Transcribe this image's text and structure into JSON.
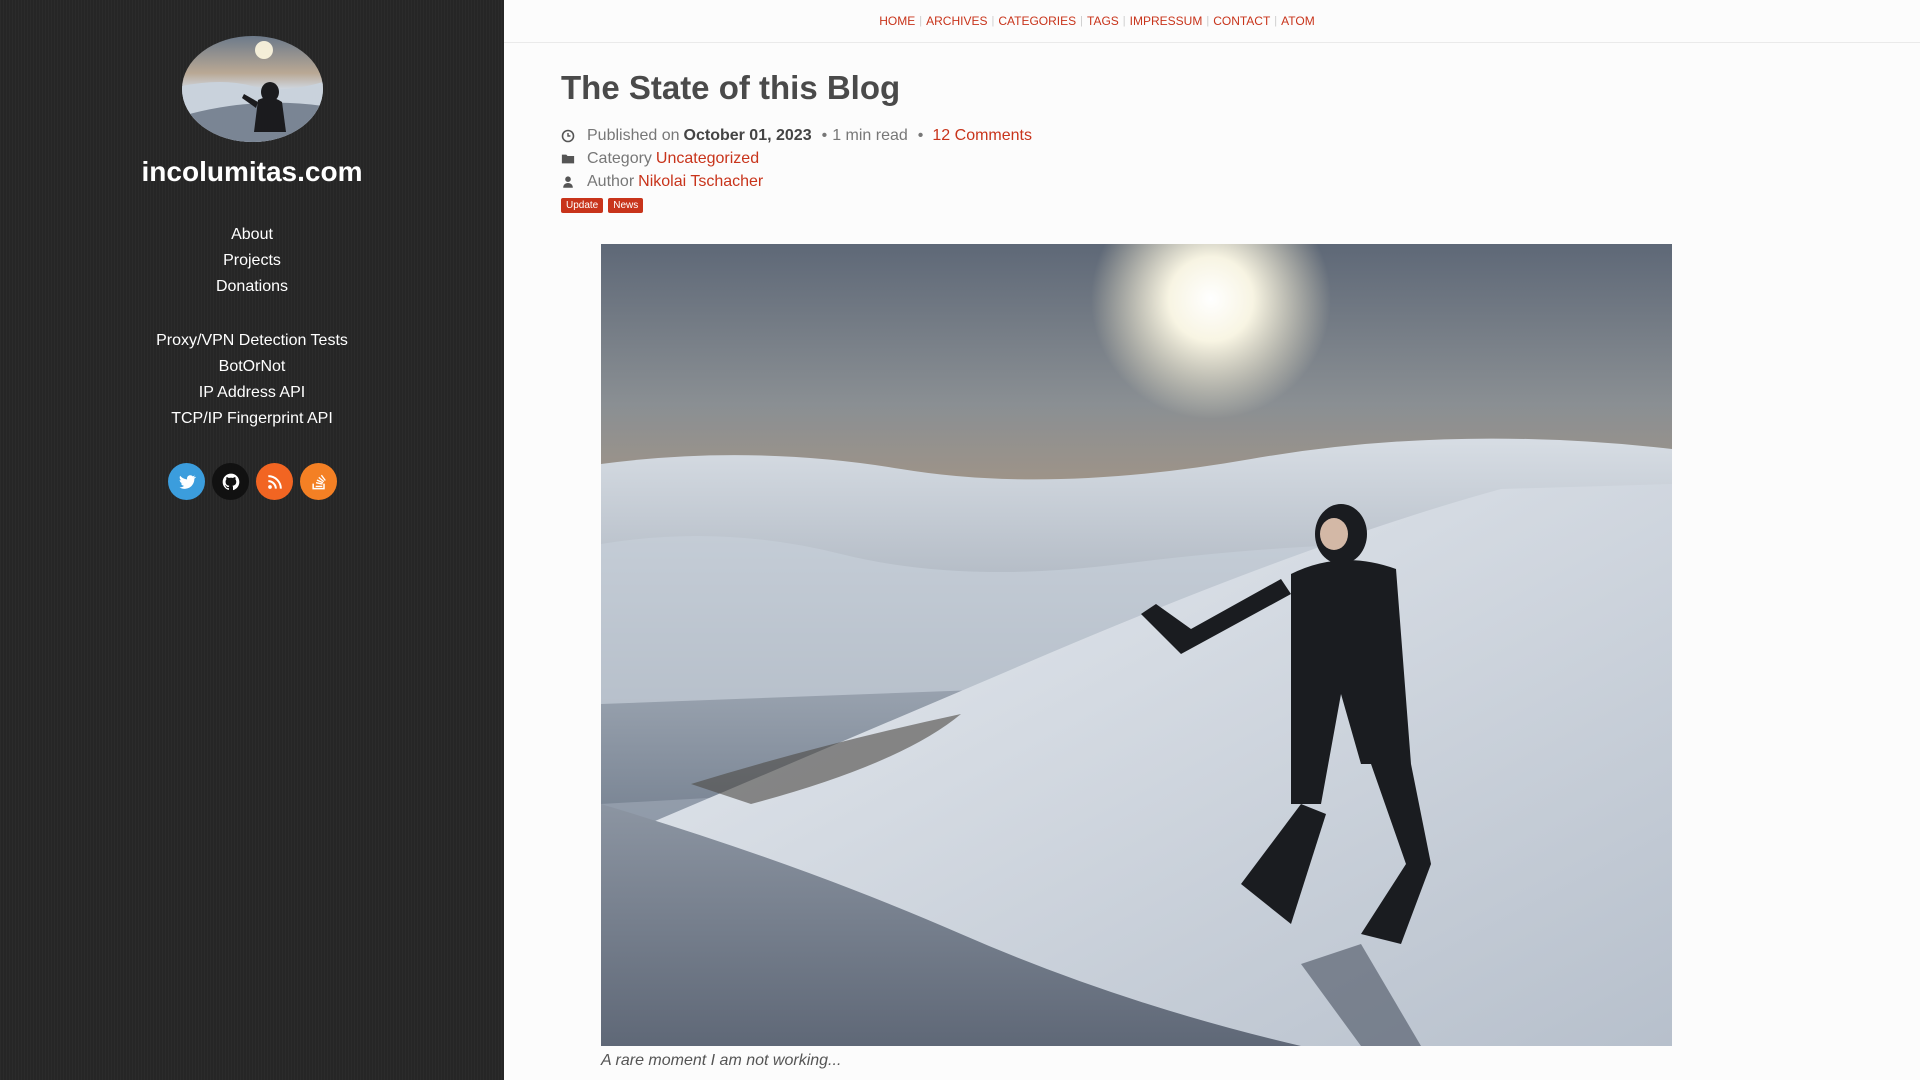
{
  "sidebar": {
    "site_title": "incolumitas.com",
    "nav_primary": [
      {
        "label": "About"
      },
      {
        "label": "Projects"
      },
      {
        "label": "Donations"
      }
    ],
    "nav_secondary": [
      {
        "label": "Proxy/VPN Detection Tests"
      },
      {
        "label": "BotOrNot"
      },
      {
        "label": "IP Address API"
      },
      {
        "label": "TCP/IP Fingerprint API"
      }
    ],
    "social": [
      {
        "icon": "twitter-icon",
        "color": "#3b9ddd"
      },
      {
        "icon": "github-icon",
        "color": "#111111"
      },
      {
        "icon": "rss-icon",
        "color": "#f26522"
      },
      {
        "icon": "stackoverflow-icon",
        "color": "#f48024"
      }
    ]
  },
  "topnav": {
    "items": [
      "HOME",
      "ARCHIVES",
      "CATEGORIES",
      "TAGS",
      "IMPRESSUM",
      "CONTACT",
      "ATOM"
    ]
  },
  "post": {
    "title": "The State of this Blog",
    "published_prefix": "Published on",
    "date": "October 01, 2023",
    "read_time": "1 min read",
    "comments": "12 Comments",
    "category_label": "Category",
    "category": "Uncategorized",
    "author_label": "Author",
    "author": "Nikolai Tschacher",
    "tags": [
      "Update",
      "News"
    ],
    "caption": "A rare moment I am not working..."
  },
  "colors": {
    "accent": "#c8341b",
    "sidebar_bg": "#262626"
  }
}
